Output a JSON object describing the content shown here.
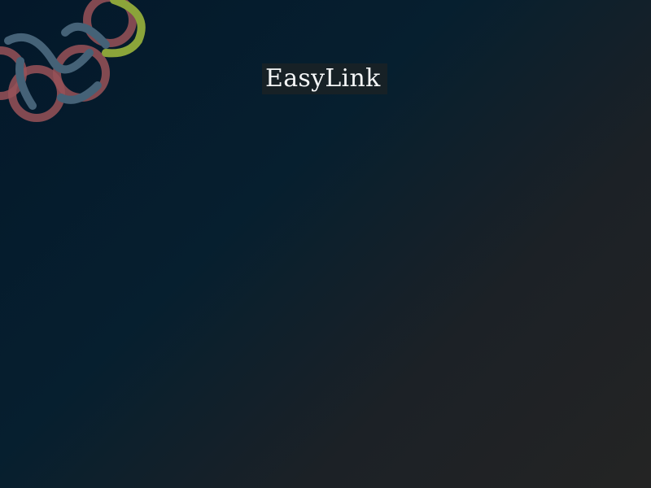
{
  "app": {
    "title": "EasyLink"
  },
  "decor": {
    "logo_icon": "celtic-knot-icon",
    "colors": {
      "knot_red": "#b85a5e",
      "knot_blue": "#4d6a80",
      "knot_green": "#9ab43c",
      "bg_start": "#04182a",
      "bg_end": "#242424"
    }
  }
}
